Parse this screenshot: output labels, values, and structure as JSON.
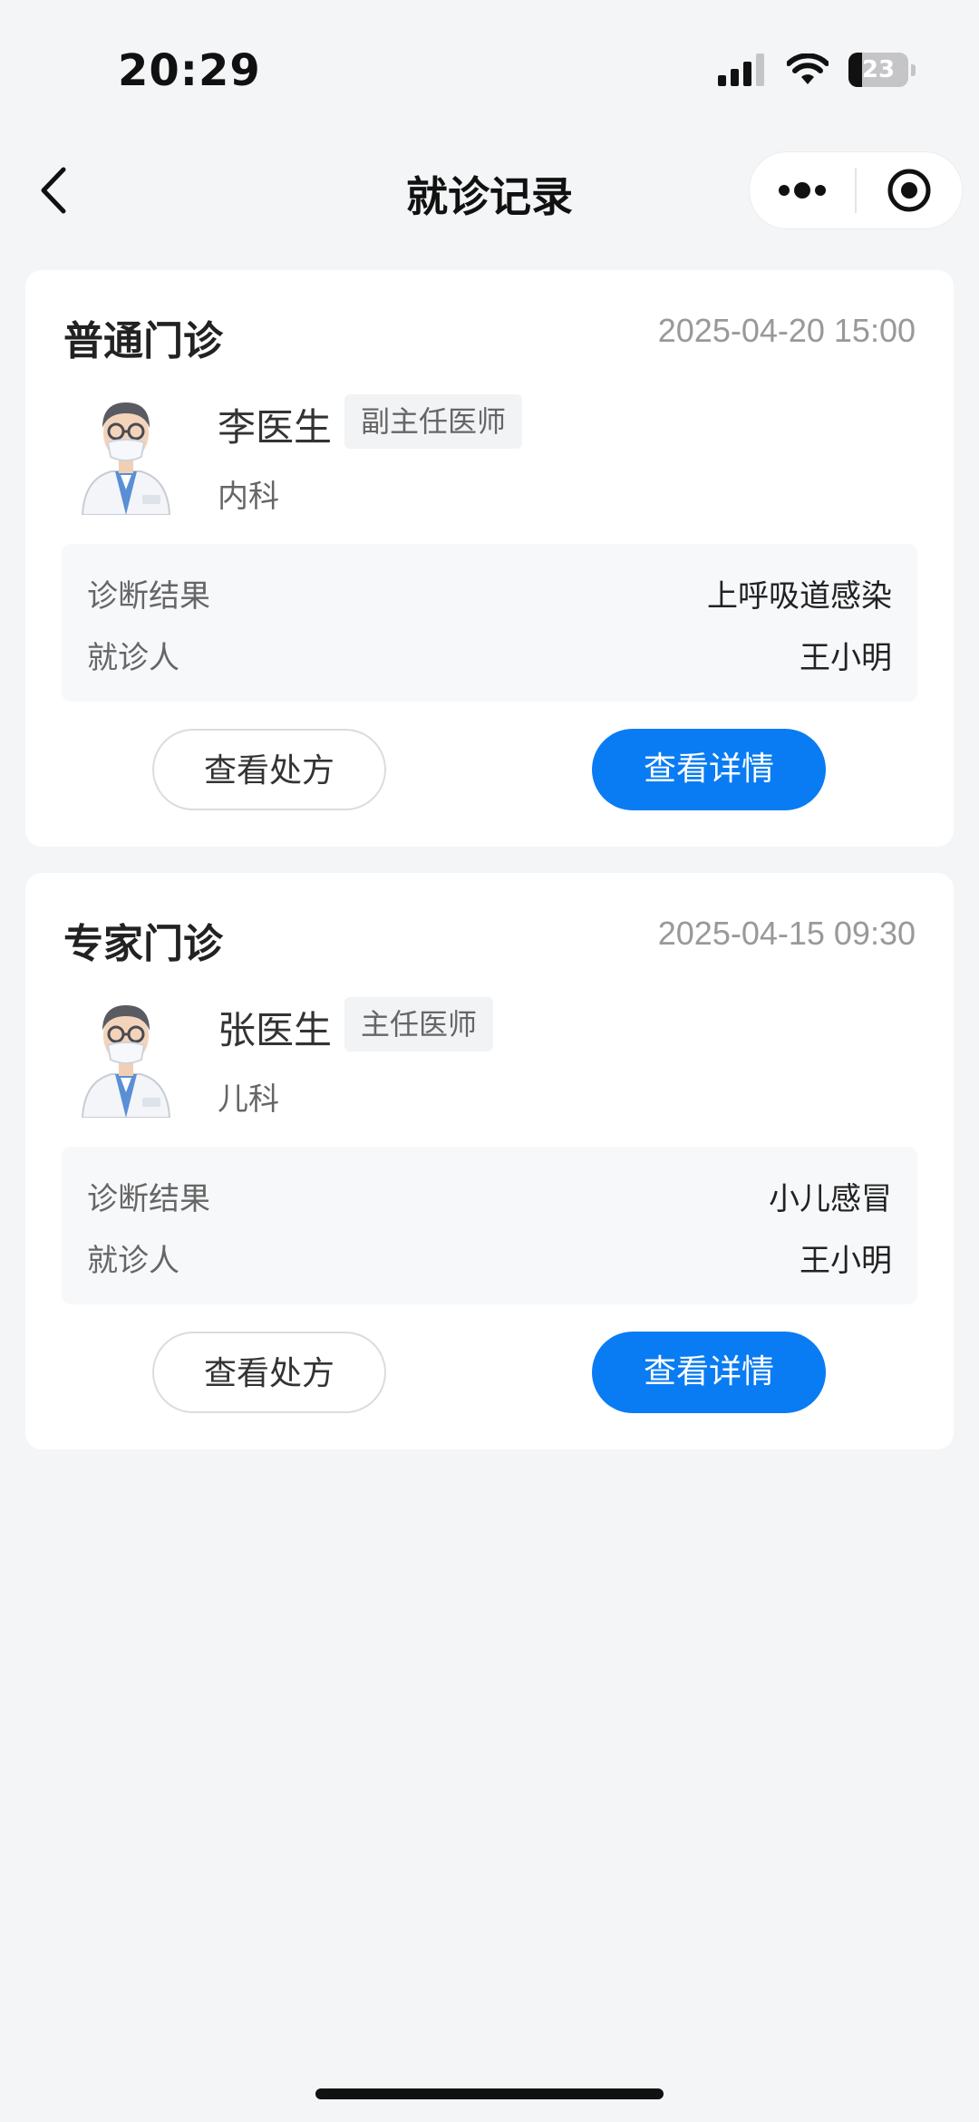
{
  "status_bar": {
    "time": "20:29",
    "battery_level": "23",
    "battery_fraction": 0.23
  },
  "nav": {
    "title": "就诊记录"
  },
  "records": [
    {
      "visit_type": "普通门诊",
      "datetime": "2025-04-20 15:00",
      "doctor_name": "李医生",
      "doctor_title": "副主任医师",
      "department": "内科",
      "diagnosis_label": "诊断结果",
      "diagnosis": "上呼吸道感染",
      "patient_label": "就诊人",
      "patient": "王小明",
      "prescription_button": "查看处方",
      "detail_button": "查看详情"
    },
    {
      "visit_type": "专家门诊",
      "datetime": "2025-04-15 09:30",
      "doctor_name": "张医生",
      "doctor_title": "主任医师",
      "department": "儿科",
      "diagnosis_label": "诊断结果",
      "diagnosis": "小儿感冒",
      "patient_label": "就诊人",
      "patient": "王小明",
      "prescription_button": "查看处方",
      "detail_button": "查看详情"
    }
  ],
  "icons": {
    "back": "chevron-left-icon",
    "more": "more-dots-icon",
    "close": "target-circle-icon",
    "signal": "cellular-signal-icon",
    "wifi": "wifi-icon",
    "battery": "battery-icon",
    "avatar": "doctor-avatar"
  },
  "colors": {
    "primary": "#0a7cf3",
    "background": "#f4f5f7",
    "card": "#ffffff",
    "info_box": "#f7f8fa"
  }
}
